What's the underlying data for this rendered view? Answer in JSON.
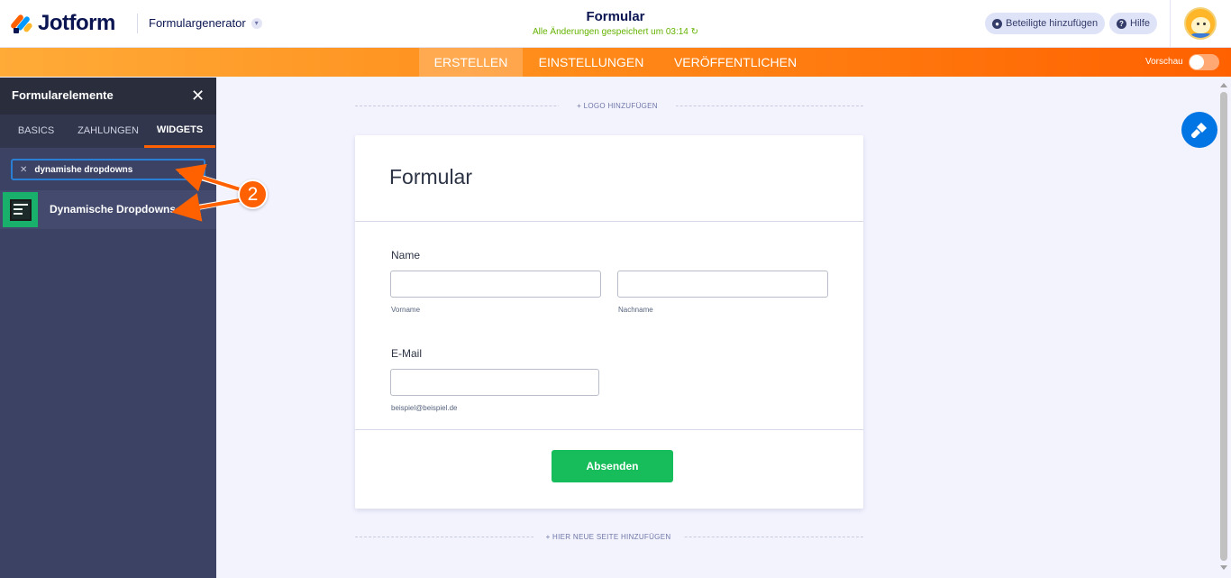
{
  "header": {
    "logo_text": "Jotform",
    "builder_label": "Formulargenerator",
    "form_title": "Formular",
    "save_status": "Alle Änderungen gespeichert um 03:14",
    "share_label": "Beteiligte hinzufügen",
    "help_label": "Hilfe"
  },
  "nav": {
    "create": "ERSTELLEN",
    "settings": "EINSTELLUNGEN",
    "publish": "VERÖFFENTLICHEN",
    "preview": "Vorschau",
    "preview_on": false
  },
  "panel": {
    "title": "Formularelemente",
    "tabs": [
      "BASICS",
      "ZAHLUNGEN",
      "WIDGETS"
    ],
    "active_tab": "WIDGETS",
    "search_value": "dynamishe dropdowns",
    "results": [
      {
        "label": "Dynamische Dropdowns",
        "icon": "dropdown-widget-icon"
      }
    ]
  },
  "canvas": {
    "add_logo": "+ LOGO HINZUFÜGEN",
    "add_page": "+ HIER NEUE SEITE HINZUFÜGEN"
  },
  "form": {
    "title": "Formular",
    "name_label": "Name",
    "first_sublabel": "Vorname",
    "last_sublabel": "Nachname",
    "email_label": "E-Mail",
    "email_sublabel": "beispiel@beispiel.de",
    "submit": "Absenden"
  },
  "annotation": {
    "badge": "2"
  },
  "colors": {
    "brand_orange": "#ff6100",
    "brand_blue": "#0099ff",
    "submit_green": "#18bd5b",
    "panel_bg": "#3b4263",
    "save_green": "#64b200"
  }
}
